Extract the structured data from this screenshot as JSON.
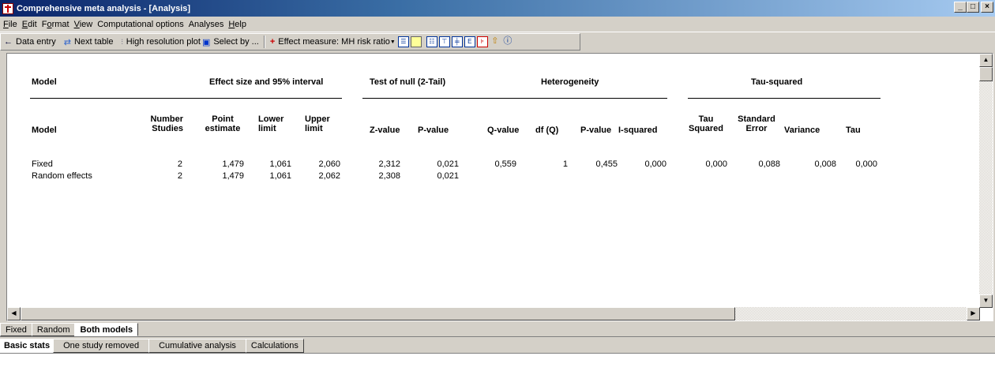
{
  "window": {
    "title": "Comprehensive meta analysis - [Analysis]",
    "min_btn": "_",
    "max_btn": "□",
    "close_btn": "×"
  },
  "menu": {
    "file": "F",
    "file_rest": "ile",
    "edit": "E",
    "edit_rest": "dit",
    "format_pre": "F",
    "format_o": "o",
    "format_rest": "rmat",
    "view": "V",
    "view_rest": "iew",
    "computational": "Computational options",
    "analyses": "Analyses",
    "help": "H",
    "help_rest": "elp"
  },
  "toolbar": {
    "data_entry": "Data entry",
    "next_table": "Next table",
    "high_res_plot": "High resolution plot",
    "select_by": "Select by ...",
    "effect_measure": "Effect measure:",
    "effect_value": "MH risk ratio"
  },
  "table": {
    "group_model": "Model",
    "group_effect": "Effect size and 95% interval",
    "group_null": "Test of null (2-Tail)",
    "group_het": "Heterogeneity",
    "group_tau": "Tau-squared",
    "col_model": "Model",
    "col_number_1": "Number",
    "col_number_2": "Studies",
    "col_point_1": "Point",
    "col_point_2": "estimate",
    "col_lower_1": "Lower",
    "col_lower_2": "limit",
    "col_upper_1": "Upper",
    "col_upper_2": "limit",
    "col_z": "Z-value",
    "col_p": "P-value",
    "col_q": "Q-value",
    "col_df": "df (Q)",
    "col_p2": "P-value",
    "col_isq": "I-squared",
    "col_tau_sq_1": "Tau",
    "col_tau_sq_2": "Squared",
    "col_se_1": "Standard",
    "col_se_2": "Error",
    "col_var": "Variance",
    "col_tau": "Tau",
    "rows": [
      {
        "model": "Fixed",
        "number": "2",
        "point": "1,479",
        "lower": "1,061",
        "upper": "2,060",
        "z": "2,312",
        "p": "0,021",
        "q": "0,559",
        "df": "1",
        "p2": "0,455",
        "isq": "0,000",
        "tausq": "0,000",
        "se": "0,088",
        "var": "0,008",
        "tau": "0,000"
      },
      {
        "model": "Random effects",
        "number": "2",
        "point": "1,479",
        "lower": "1,061",
        "upper": "2,062",
        "z": "2,308",
        "p": "0,021",
        "q": "",
        "df": "",
        "p2": "",
        "isq": "",
        "tausq": "",
        "se": "",
        "var": "",
        "tau": ""
      }
    ]
  },
  "tabs_model": [
    "Fixed",
    "Random",
    "Both models"
  ],
  "tabs_view": [
    "Basic stats",
    "One study removed",
    "Cumulative analysis",
    "Calculations"
  ]
}
